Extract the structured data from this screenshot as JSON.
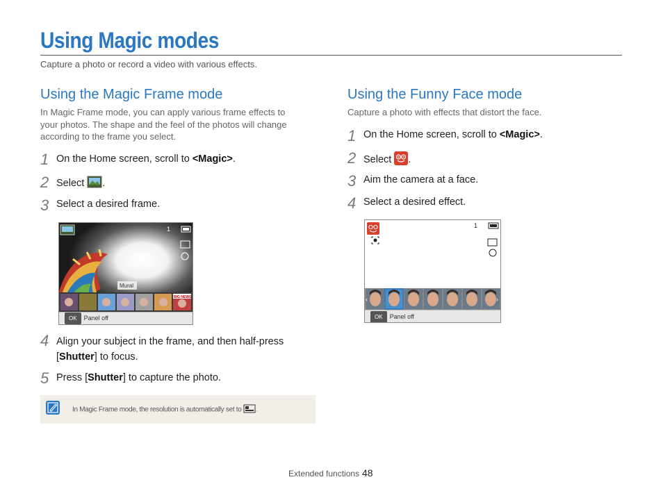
{
  "page": {
    "title": "Using Magic modes",
    "subtitle": "Capture a photo or record a video with various effects."
  },
  "left": {
    "heading": "Using the Magic Frame mode",
    "intro_lines": [
      "In Magic Frame mode, you can apply various frame effects to",
      "your photos. The shape and the feel of the photos will change",
      "according to the frame you select."
    ],
    "steps": [
      {
        "num": "1",
        "pre": "On the Home screen, scroll to ",
        "kw": "<Magic>",
        "post": "."
      },
      {
        "num": "2",
        "pre": "Select ",
        "post": "."
      },
      {
        "num": "3",
        "pre": "Select a desired frame."
      }
    ],
    "screen": {
      "frame_label": "Mural",
      "panel_ok": "OK",
      "panel_label": "Panel off",
      "shot_count": "1",
      "thumb_text": "BIG NEWS"
    },
    "steps_after": [
      {
        "num": "4",
        "line1": "Align your subject in the frame, and then half-press",
        "bracket_open": "[",
        "kw": "Shutter",
        "rest": "] to focus."
      },
      {
        "num": "5",
        "pre": "Press [",
        "kw": "Shutter",
        "post": "] to capture the photo."
      }
    ],
    "note": {
      "text": "In Magic Frame mode, the resolution is automatically set to ",
      "end": "."
    }
  },
  "right": {
    "heading": "Using the Funny Face mode",
    "intro": "Capture a photo with effects that distort the face.",
    "steps": [
      {
        "num": "1",
        "pre": "On the Home screen, scroll to ",
        "kw": "<Magic>",
        "post": "."
      },
      {
        "num": "2",
        "pre": "Select ",
        "post": "."
      },
      {
        "num": "3",
        "pre": "Aim the camera at a face."
      },
      {
        "num": "4",
        "pre": "Select a desired effect."
      }
    ],
    "screen": {
      "panel_ok": "OK",
      "panel_label": "Panel off",
      "shot_count": "1"
    }
  },
  "footer": {
    "section": "Extended functions",
    "page": "48"
  },
  "colors": {
    "accent": "#2a78c2",
    "note_bg": "#f2efe9"
  }
}
